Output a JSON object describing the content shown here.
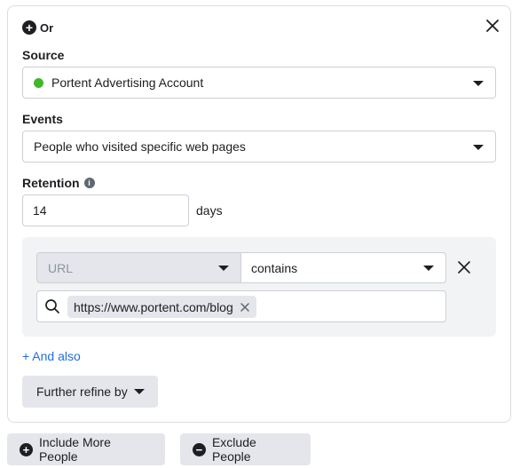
{
  "header": {
    "label": "Or"
  },
  "source": {
    "label": "Source",
    "value": "Portent Advertising Account",
    "status_color": "#42b72a"
  },
  "events": {
    "label": "Events",
    "value": "People who visited specific web pages"
  },
  "retention": {
    "label": "Retention",
    "value": "14",
    "unit": "days"
  },
  "rule": {
    "field": "URL",
    "operator": "contains",
    "tokens": [
      "https://www.portent.com/blog"
    ]
  },
  "actions": {
    "and_also": "+ And also",
    "further_refine": "Further refine by",
    "include_more": "Include More People",
    "exclude": "Exclude People"
  },
  "colors": {
    "link": "#216fdb",
    "button_bg": "#e4e6eb"
  }
}
